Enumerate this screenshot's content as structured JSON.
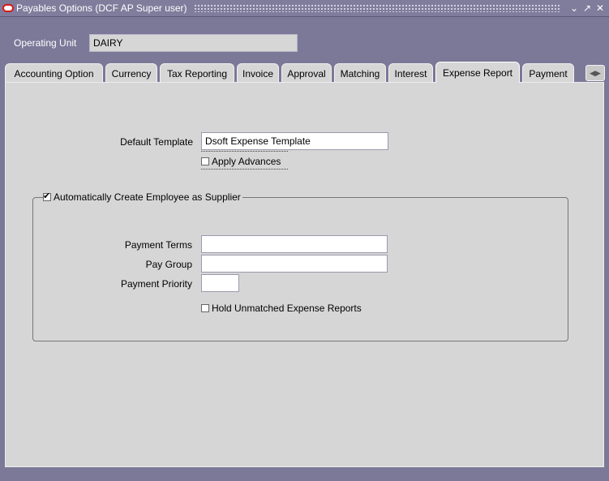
{
  "window": {
    "title": "Payables Options (DCF AP Super user)",
    "controls": [
      "minimize-icon",
      "maximize-icon",
      "close-icon"
    ]
  },
  "header": {
    "operating_unit_label": "Operating Unit",
    "operating_unit_value": "DAIRY"
  },
  "tabs": [
    {
      "label": "Accounting Option"
    },
    {
      "label": "Currency"
    },
    {
      "label": "Tax Reporting"
    },
    {
      "label": "Invoice"
    },
    {
      "label": "Approval"
    },
    {
      "label": "Matching"
    },
    {
      "label": "Interest"
    },
    {
      "label": "Expense Report",
      "active": true
    },
    {
      "label": "Payment"
    }
  ],
  "expense_report": {
    "default_template_label": "Default Template",
    "default_template_value": "Dsoft Expense Template",
    "apply_advances_label": "Apply Advances",
    "apply_advances_checked": false,
    "auto_create_label": "Automatically Create Employee as Supplier",
    "auto_create_checked": true,
    "payment_terms_label": "Payment Terms",
    "payment_terms_value": "",
    "pay_group_label": "Pay Group",
    "pay_group_value": "",
    "payment_priority_label": "Payment Priority",
    "payment_priority_value": "",
    "hold_unmatched_label": "Hold Unmatched Expense Reports",
    "hold_unmatched_checked": false
  },
  "colors": {
    "window_background": "#7b7898",
    "panel_background": "#d6d6d6",
    "oracle_red": "#d81818"
  }
}
